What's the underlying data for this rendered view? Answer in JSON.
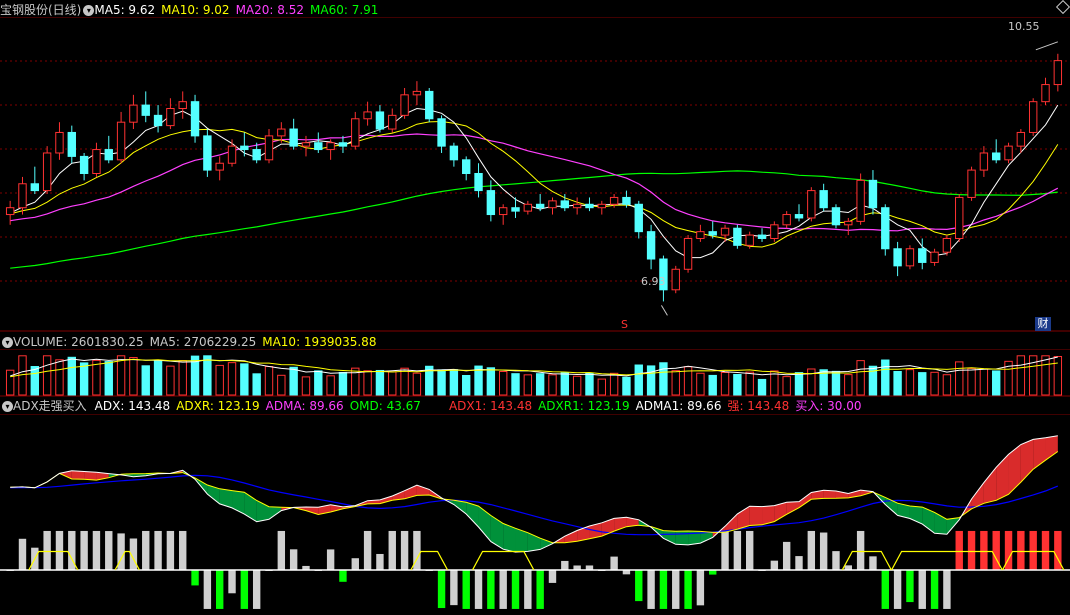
{
  "colors": {
    "up": "#ff3232",
    "down": "#54ffff",
    "ma5": "#ffffff",
    "ma10": "#ffff00",
    "ma20": "#ff40ff",
    "ma60": "#00ff00",
    "adx": "#ffffff",
    "adxr": "#ffff00",
    "adma": "#0000ff",
    "omd": "#00ff00",
    "grid": "#800000",
    "label_red": "#ff3232",
    "label_green": "#00ff00"
  },
  "price_panel": {
    "stock_name": "宝钢股份(日线)",
    "ma5_label": "MA5: 9.62",
    "ma10_label": "MA10: 9.02",
    "ma20_label": "MA20: 8.52",
    "ma60_label": "MA60: 7.91",
    "high_label": "10.55",
    "low_label": "6.93",
    "s_marker": "S",
    "fin_marker": "财"
  },
  "volume_panel": {
    "volume_label": "VOLUME: 2601830.25",
    "ma5_label": "MA5: 2706229.25",
    "ma10_label": "MA10: 1939035.88"
  },
  "adx_panel": {
    "title": "ADX走强买入",
    "adx_label": "ADX: 143.48",
    "adxr_label": "ADXR: 123.19",
    "adma_label": "ADMA: 89.66",
    "omd_label": "OMD: 43.67",
    "adx1_label": "ADX1: 143.48",
    "adxr1_label": "ADXR1: 123.19",
    "adma1_label": "ADMA1: 89.66",
    "strong_label": "强: 143.48",
    "buy_label": "买入: 30.00"
  },
  "chart_data": {
    "type": "candlestick",
    "title": "宝钢股份(日线)",
    "price_range": [
      6.6,
      11.0
    ],
    "high_marked": 10.55,
    "low_marked": 6.93,
    "candle_count": 86,
    "candles": [
      [
        8.2,
        8.4,
        8.05,
        8.3
      ],
      [
        8.3,
        8.75,
        8.2,
        8.65
      ],
      [
        8.65,
        8.9,
        8.5,
        8.55
      ],
      [
        8.55,
        9.2,
        8.5,
        9.1
      ],
      [
        9.1,
        9.55,
        9.0,
        9.4
      ],
      [
        9.4,
        9.5,
        8.95,
        9.05
      ],
      [
        9.05,
        9.1,
        8.7,
        8.8
      ],
      [
        8.8,
        9.25,
        8.75,
        9.15
      ],
      [
        9.15,
        9.35,
        8.95,
        9.0
      ],
      [
        9.0,
        9.7,
        8.95,
        9.55
      ],
      [
        9.55,
        9.95,
        9.45,
        9.8
      ],
      [
        9.8,
        10.0,
        9.55,
        9.65
      ],
      [
        9.65,
        9.8,
        9.4,
        9.5
      ],
      [
        9.5,
        9.9,
        9.45,
        9.75
      ],
      [
        9.75,
        10.0,
        9.6,
        9.85
      ],
      [
        9.85,
        9.95,
        9.25,
        9.35
      ],
      [
        9.35,
        9.45,
        8.75,
        8.85
      ],
      [
        8.85,
        9.05,
        8.7,
        8.95
      ],
      [
        8.95,
        9.3,
        8.9,
        9.2
      ],
      [
        9.2,
        9.4,
        9.05,
        9.15
      ],
      [
        9.15,
        9.25,
        8.95,
        9.0
      ],
      [
        9.0,
        9.45,
        8.95,
        9.35
      ],
      [
        9.35,
        9.55,
        9.25,
        9.45
      ],
      [
        9.45,
        9.6,
        9.15,
        9.2
      ],
      [
        9.2,
        9.35,
        9.05,
        9.25
      ],
      [
        9.25,
        9.4,
        9.1,
        9.15
      ],
      [
        9.15,
        9.3,
        9.0,
        9.25
      ],
      [
        9.25,
        9.35,
        9.1,
        9.2
      ],
      [
        9.2,
        9.7,
        9.15,
        9.6
      ],
      [
        9.6,
        9.85,
        9.5,
        9.7
      ],
      [
        9.7,
        9.8,
        9.4,
        9.45
      ],
      [
        9.45,
        9.75,
        9.4,
        9.65
      ],
      [
        9.65,
        10.05,
        9.6,
        9.95
      ],
      [
        9.95,
        10.15,
        9.8,
        10.0
      ],
      [
        10.0,
        10.05,
        9.55,
        9.6
      ],
      [
        9.6,
        9.65,
        9.1,
        9.2
      ],
      [
        9.2,
        9.25,
        8.9,
        9.0
      ],
      [
        9.0,
        9.05,
        8.7,
        8.8
      ],
      [
        8.8,
        8.95,
        8.45,
        8.55
      ],
      [
        8.55,
        8.7,
        8.1,
        8.2
      ],
      [
        8.2,
        8.35,
        8.05,
        8.3
      ],
      [
        8.3,
        8.45,
        8.15,
        8.25
      ],
      [
        8.25,
        8.4,
        8.2,
        8.35
      ],
      [
        8.35,
        8.5,
        8.25,
        8.3
      ],
      [
        8.3,
        8.45,
        8.2,
        8.4
      ],
      [
        8.4,
        8.5,
        8.25,
        8.3
      ],
      [
        8.3,
        8.45,
        8.2,
        8.35
      ],
      [
        8.35,
        8.45,
        8.25,
        8.3
      ],
      [
        8.3,
        8.4,
        8.2,
        8.35
      ],
      [
        8.35,
        8.5,
        8.3,
        8.45
      ],
      [
        8.45,
        8.55,
        8.3,
        8.35
      ],
      [
        8.35,
        8.4,
        7.85,
        7.95
      ],
      [
        7.95,
        8.05,
        7.4,
        7.55
      ],
      [
        7.55,
        7.6,
        6.93,
        7.1
      ],
      [
        7.1,
        7.45,
        7.05,
        7.4
      ],
      [
        7.4,
        7.9,
        7.35,
        7.85
      ],
      [
        7.85,
        8.05,
        7.8,
        7.95
      ],
      [
        7.95,
        8.1,
        7.85,
        7.9
      ],
      [
        7.9,
        8.05,
        7.8,
        8.0
      ],
      [
        8.0,
        8.05,
        7.7,
        7.75
      ],
      [
        7.75,
        7.95,
        7.7,
        7.9
      ],
      [
        7.9,
        8.0,
        7.8,
        7.85
      ],
      [
        7.85,
        8.1,
        7.8,
        8.05
      ],
      [
        8.05,
        8.25,
        8.0,
        8.2
      ],
      [
        8.2,
        8.35,
        8.1,
        8.15
      ],
      [
        8.15,
        8.6,
        8.1,
        8.55
      ],
      [
        8.55,
        8.65,
        8.25,
        8.3
      ],
      [
        8.3,
        8.35,
        8.0,
        8.05
      ],
      [
        8.05,
        8.15,
        7.9,
        8.1
      ],
      [
        8.1,
        8.8,
        8.05,
        8.7
      ],
      [
        8.7,
        8.85,
        8.2,
        8.3
      ],
      [
        8.3,
        8.35,
        7.6,
        7.7
      ],
      [
        7.7,
        7.8,
        7.3,
        7.45
      ],
      [
        7.45,
        7.75,
        7.4,
        7.7
      ],
      [
        7.7,
        7.85,
        7.4,
        7.5
      ],
      [
        7.5,
        7.7,
        7.45,
        7.65
      ],
      [
        7.65,
        7.9,
        7.6,
        7.85
      ],
      [
        7.85,
        8.5,
        7.8,
        8.45
      ],
      [
        8.45,
        8.9,
        8.4,
        8.85
      ],
      [
        8.85,
        9.2,
        8.75,
        9.1
      ],
      [
        9.1,
        9.3,
        8.95,
        9.0
      ],
      [
        9.0,
        9.25,
        8.95,
        9.2
      ],
      [
        9.2,
        9.45,
        9.1,
        9.4
      ],
      [
        9.4,
        9.9,
        9.35,
        9.85
      ],
      [
        9.85,
        10.2,
        9.8,
        10.1
      ],
      [
        10.1,
        10.55,
        10.0,
        10.45
      ]
    ],
    "volume_range": [
      0,
      6000000
    ],
    "adx_range": [
      -40,
      150
    ]
  }
}
